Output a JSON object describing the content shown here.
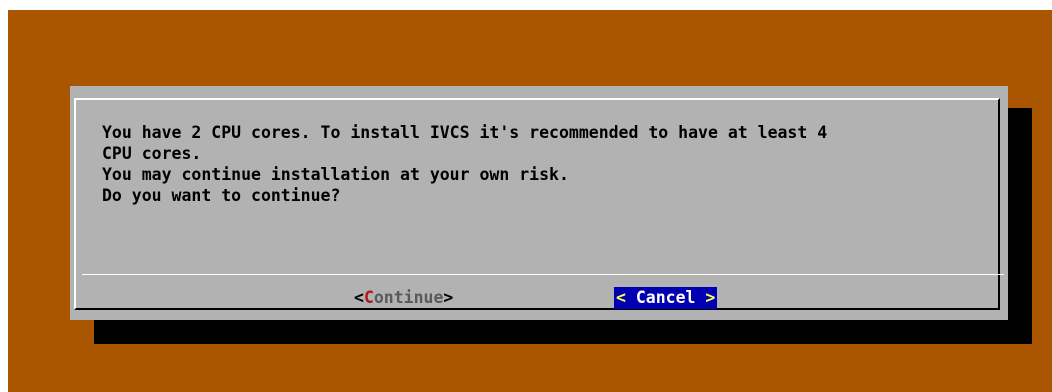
{
  "dialog": {
    "message_lines": [
      "You have 2 CPU cores. To install IVCS it's recommended to have at least 4",
      "CPU cores.",
      "You may continue installation at your own risk.",
      "Do you want to continue?"
    ]
  },
  "buttons": {
    "continue": {
      "open": "<",
      "hotkey": "C",
      "rest": "ontinue",
      "close": ">"
    },
    "cancel": {
      "open": "< ",
      "label": "Cancel",
      "close": " >",
      "focused": true
    }
  },
  "colors": {
    "background": "#aa5500",
    "dialog": "#b2b2b2",
    "shadow": "#000000",
    "focus_bg": "#0000b2",
    "hotkey": "#b21818"
  }
}
